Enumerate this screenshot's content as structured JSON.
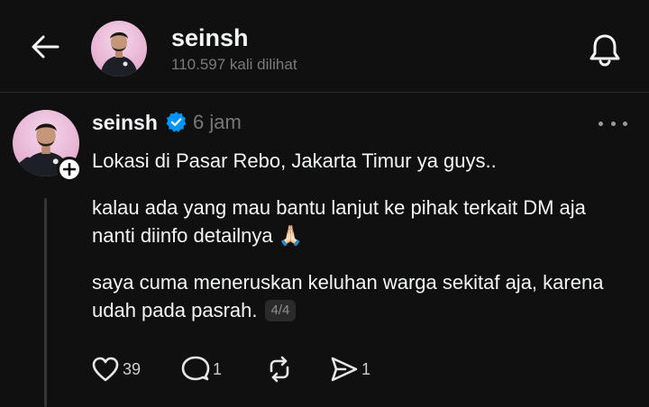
{
  "header": {
    "back_icon": "arrow-left-icon",
    "username": "seinsh",
    "views": "110.597 kali dilihat",
    "bell_icon": "bell-icon"
  },
  "post": {
    "username": "seinsh",
    "verified_icon": "verified-badge-icon",
    "verified_color": "#0095f6",
    "time": "6 jam",
    "more_icon": "more-horizontal-icon",
    "follow_icon": "plus-icon",
    "paragraphs": [
      "Lokasi di Pasar Rebo, Jakarta Timur ya guys..",
      "kalau ada yang mau bantu lanjut ke pihak terkait DM aja nanti diinfo detailnya 🙏🏻",
      "saya cuma meneruskan keluhan warga sekitaf aja, karena udah pada pasrah."
    ],
    "page_indicator": "4/4",
    "actions": {
      "like": {
        "icon": "heart-icon",
        "count": "39"
      },
      "comment": {
        "icon": "comment-icon",
        "count": "1"
      },
      "repost": {
        "icon": "repost-icon"
      },
      "share": {
        "icon": "send-icon",
        "count": "1"
      }
    }
  },
  "colors": {
    "background": "#101010",
    "text": "#f3f5f7",
    "muted": "#777777",
    "divider": "#2a2a2a"
  }
}
